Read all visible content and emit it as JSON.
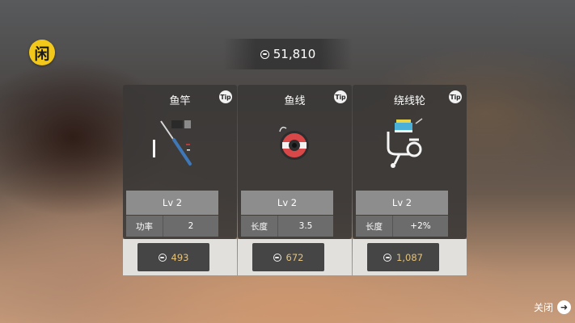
{
  "logo": {
    "glyph": "闲"
  },
  "coins": {
    "balance": "51,810"
  },
  "cards": [
    {
      "title": "鱼竿",
      "tip": "Tip",
      "level": "Lv 2",
      "stat_label": "功率",
      "stat_value": "2",
      "price": "493",
      "art_icon": "fishing-rod-icon"
    },
    {
      "title": "鱼线",
      "tip": "Tip",
      "level": "Lv 2",
      "stat_label": "长度",
      "stat_value": "3.5",
      "price": "672",
      "art_icon": "fishing-line-spool-icon"
    },
    {
      "title": "绕线轮",
      "tip": "Tip",
      "level": "Lv 2",
      "stat_label": "长度",
      "stat_value": "+2%",
      "price": "1,087",
      "art_icon": "fishing-reel-icon"
    }
  ],
  "close": {
    "label": "关闭"
  },
  "colors": {
    "price_text": "#e6c27a",
    "logo_bg": "#f2c81a",
    "level_bg": "#8d8d8d",
    "stat_bg": "#6c6c6c"
  }
}
